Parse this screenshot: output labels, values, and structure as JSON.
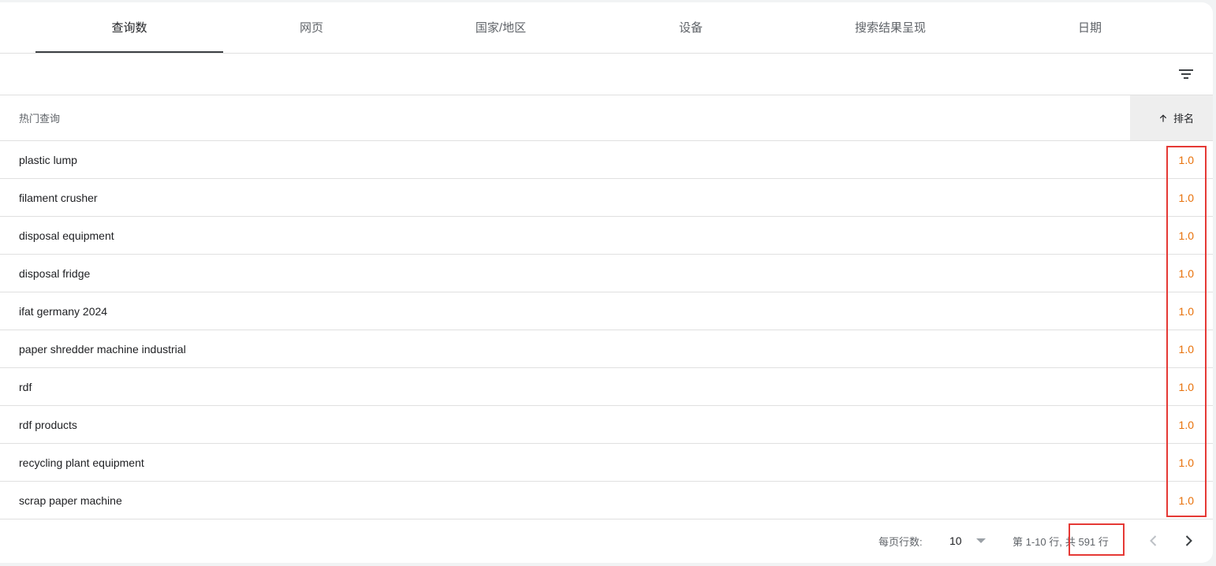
{
  "tabs": [
    {
      "label": "查询数",
      "active": true
    },
    {
      "label": "网页",
      "active": false
    },
    {
      "label": "国家/地区",
      "active": false
    },
    {
      "label": "设备",
      "active": false
    },
    {
      "label": "搜索结果呈现",
      "active": false
    },
    {
      "label": "日期",
      "active": false
    }
  ],
  "toolbar": {
    "filter_icon": "filter-list-icon"
  },
  "table": {
    "columns": {
      "query": "热门查询",
      "rank": "排名"
    },
    "sort": {
      "column": "rank",
      "direction": "ascending",
      "icon": "arrow-up-icon"
    },
    "rows": [
      {
        "query": "plastic lump",
        "rank": "1.0"
      },
      {
        "query": "filament crusher",
        "rank": "1.0"
      },
      {
        "query": "disposal equipment",
        "rank": "1.0"
      },
      {
        "query": "disposal fridge",
        "rank": "1.0"
      },
      {
        "query": "ifat germany 2024",
        "rank": "1.0"
      },
      {
        "query": "paper shredder machine industrial",
        "rank": "1.0"
      },
      {
        "query": "rdf",
        "rank": "1.0"
      },
      {
        "query": "rdf products",
        "rank": "1.0"
      },
      {
        "query": "recycling plant equipment",
        "rank": "1.0"
      },
      {
        "query": "scrap paper machine",
        "rank": "1.0"
      }
    ]
  },
  "pagination": {
    "rows_per_page_label": "每页行数:",
    "rows_per_page": "10",
    "range_text": "第 1-10 行,",
    "total_text": "共 591 行",
    "prev_icon": "chevron-left-icon",
    "next_icon": "chevron-right-icon"
  },
  "colors": {
    "rank_value": "#e8710a",
    "highlight_box": "#e53935",
    "active_tab_underline": "#3c4043",
    "sorted_header_bg": "#eeeeee"
  }
}
